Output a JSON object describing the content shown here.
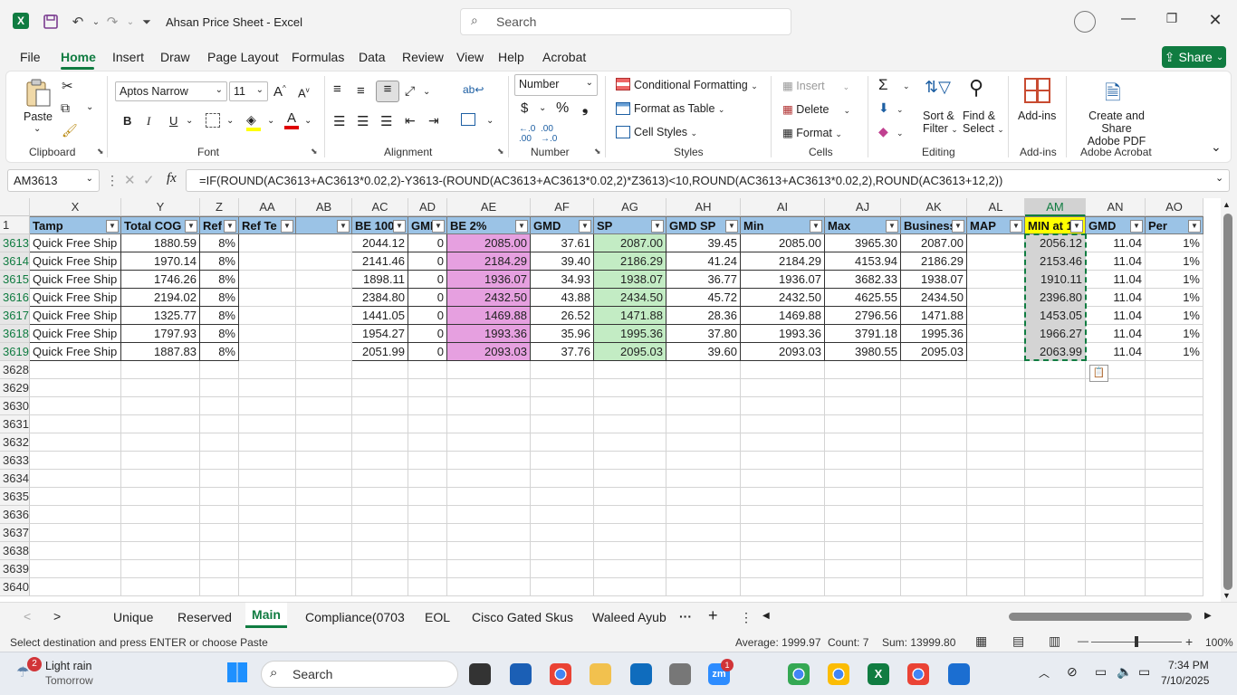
{
  "window": {
    "title": "Ahsan Price Sheet  -  Excel",
    "search_placeholder": "Search"
  },
  "menu": {
    "tabs": [
      "File",
      "Home",
      "Insert",
      "Draw",
      "Page Layout",
      "Formulas",
      "Data",
      "Review",
      "View",
      "Help",
      "Acrobat"
    ],
    "active": "Home",
    "share_label": "Share"
  },
  "ribbon": {
    "clipboard": {
      "paste": "Paste",
      "group": "Clipboard"
    },
    "font": {
      "name": "Aptos Narrow",
      "size": "11",
      "group": "Font"
    },
    "alignment": {
      "group": "Alignment"
    },
    "number": {
      "format": "Number",
      "group": "Number"
    },
    "styles": {
      "conditional": "Conditional Formatting",
      "format_table": "Format as Table",
      "cell_styles": "Cell Styles",
      "group": "Styles"
    },
    "cells": {
      "insert": "Insert",
      "delete": "Delete",
      "format": "Format",
      "group": "Cells"
    },
    "editing": {
      "sort": "Sort &",
      "filter": "Filter",
      "find": "Find &",
      "select": "Select",
      "group": "Editing"
    },
    "addins": {
      "label": "Add-ins",
      "group": "Add-ins"
    },
    "acrobat": {
      "line1": "Create and Share",
      "line2": "Adobe PDF",
      "group": "Adobe Acrobat"
    }
  },
  "formula_bar": {
    "name_box": "AM3613",
    "fx": "fx",
    "formula": "=IF(ROUND(AC3613+AC3613*0.02,2)-Y3613-(ROUND(AC3613+AC3613*0.02,2)*Z3613)<10,ROUND(AC3613+AC3613*0.02,2),ROUND(AC3613+12,2))"
  },
  "sheet": {
    "columns": [
      "X",
      "Y",
      "Z",
      "AA",
      "AB",
      "AC",
      "AD",
      "AE",
      "AF",
      "AG",
      "AH",
      "AI",
      "AJ",
      "AK",
      "AL",
      "AM",
      "AN",
      "AO"
    ],
    "selected_column": "AM",
    "header_row_number": "1",
    "headers": [
      "Tamp",
      "Total COG",
      "Ref",
      "Ref Te",
      "",
      "BE 100",
      "GMI",
      "BE 2%",
      "GMD",
      "SP",
      "GMD SP",
      "Min",
      "Max",
      "Business",
      "MAP",
      "MIN at 1",
      "GMD",
      "Per"
    ],
    "rows": [
      {
        "n": "3613",
        "cells": [
          "Quick Free Ship",
          "1880.59",
          "8%",
          "",
          "",
          "2044.12",
          "0",
          "2085.00",
          "37.61",
          "2087.00",
          "39.45",
          "2085.00",
          "3965.30",
          "2087.00",
          "",
          "2056.12",
          "11.04",
          "1%"
        ]
      },
      {
        "n": "3614",
        "cells": [
          "Quick Free Ship",
          "1970.14",
          "8%",
          "",
          "",
          "2141.46",
          "0",
          "2184.29",
          "39.40",
          "2186.29",
          "41.24",
          "2184.29",
          "4153.94",
          "2186.29",
          "",
          "2153.46",
          "11.04",
          "1%"
        ]
      },
      {
        "n": "3615",
        "cells": [
          "Quick Free Ship",
          "1746.26",
          "8%",
          "",
          "",
          "1898.11",
          "0",
          "1936.07",
          "34.93",
          "1938.07",
          "36.77",
          "1936.07",
          "3682.33",
          "1938.07",
          "",
          "1910.11",
          "11.04",
          "1%"
        ]
      },
      {
        "n": "3616",
        "cells": [
          "Quick Free Ship",
          "2194.02",
          "8%",
          "",
          "",
          "2384.80",
          "0",
          "2432.50",
          "43.88",
          "2434.50",
          "45.72",
          "2432.50",
          "4625.55",
          "2434.50",
          "",
          "2396.80",
          "11.04",
          "1%"
        ]
      },
      {
        "n": "3617",
        "cells": [
          "Quick Free Ship",
          "1325.77",
          "8%",
          "",
          "",
          "1441.05",
          "0",
          "1469.88",
          "26.52",
          "1471.88",
          "28.36",
          "1469.88",
          "2796.56",
          "1471.88",
          "",
          "1453.05",
          "11.04",
          "1%"
        ]
      },
      {
        "n": "3618",
        "cells": [
          "Quick Free Ship",
          "1797.93",
          "8%",
          "",
          "",
          "1954.27",
          "0",
          "1993.36",
          "35.96",
          "1995.36",
          "37.80",
          "1993.36",
          "3791.18",
          "1995.36",
          "",
          "1966.27",
          "11.04",
          "1%"
        ]
      },
      {
        "n": "3619",
        "cells": [
          "Quick Free Ship",
          "1887.83",
          "8%",
          "",
          "",
          "2051.99",
          "0",
          "2093.03",
          "37.76",
          "2095.03",
          "39.60",
          "2093.03",
          "3980.55",
          "2095.03",
          "",
          "2063.99",
          "11.04",
          "1%"
        ]
      }
    ],
    "empty_rows": [
      "3628",
      "3629",
      "3630",
      "3631",
      "3632",
      "3633",
      "3634",
      "3635",
      "3636",
      "3637",
      "3638",
      "3639",
      "3640"
    ]
  },
  "sheet_tabs": [
    "Unique",
    "Reserved",
    "Main",
    "Compliance(0703",
    "EOL",
    "Cisco Gated Skus",
    "Waleed Ayub"
  ],
  "active_sheet": "Main",
  "status": {
    "message": "Select destination and press ENTER or choose Paste",
    "average": "Average: 1999.97",
    "count": "Count: 7",
    "sum": "Sum: 13999.80",
    "zoom": "100%"
  },
  "taskbar": {
    "weather_badge": "2",
    "weather_title": "Light rain",
    "weather_sub": "Tomorrow",
    "search": "Search",
    "zoom_badge": "1",
    "time": "7:34 PM",
    "date": "7/10/2025"
  },
  "colors": {
    "excel_green": "#107c41",
    "header_blue": "#9bc3e6",
    "pink": "#e6a0e0",
    "green_fill": "#c3ecc4",
    "min_header_yellow": "#ffff00"
  }
}
